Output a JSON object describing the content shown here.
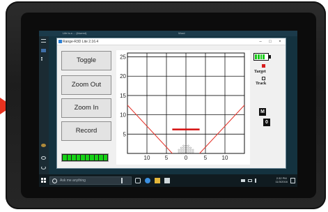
{
  "os": {
    "top_title_left": "Life is a ... (blurred)",
    "top_title_right": "Word",
    "taskbar_search_placeholder": "Ask me anything",
    "clock_time": "2:32 PM",
    "clock_date": "11/3/2016"
  },
  "app": {
    "window_title": "Range-R3D Lite 2.16.4",
    "buttons": {
      "toggle": "Toggle",
      "zoom_out": "Zoom Out",
      "zoom_in": "Zoom In",
      "record": "Record"
    },
    "signal_leds": 10,
    "status": {
      "battery_level": 0.8,
      "target_label": "Target",
      "target_selected": true,
      "track_label": "Track",
      "track_selected": false,
      "badge_m": "M",
      "badge_count": "0"
    }
  },
  "chart_data": {
    "type": "line",
    "y_ticks": [
      "25",
      "20",
      "15",
      "10",
      "5"
    ],
    "x_ticks": [
      "10",
      "5",
      "0",
      "5",
      "10"
    ],
    "xlim": [
      -15,
      15
    ],
    "ylim": [
      0,
      26
    ],
    "grid": true,
    "series": [
      {
        "color": "#e5332a",
        "kind": "cone_left",
        "x": [
          -15,
          -3.5
        ],
        "y": [
          12.5,
          0
        ]
      },
      {
        "color": "#e5332a",
        "kind": "cone_right",
        "x": [
          3.5,
          15
        ],
        "y": [
          0,
          12.5
        ]
      }
    ],
    "target_line": {
      "color": "#d40f0f",
      "x": [
        -3.5,
        3.5
      ],
      "y": 6.2
    }
  }
}
